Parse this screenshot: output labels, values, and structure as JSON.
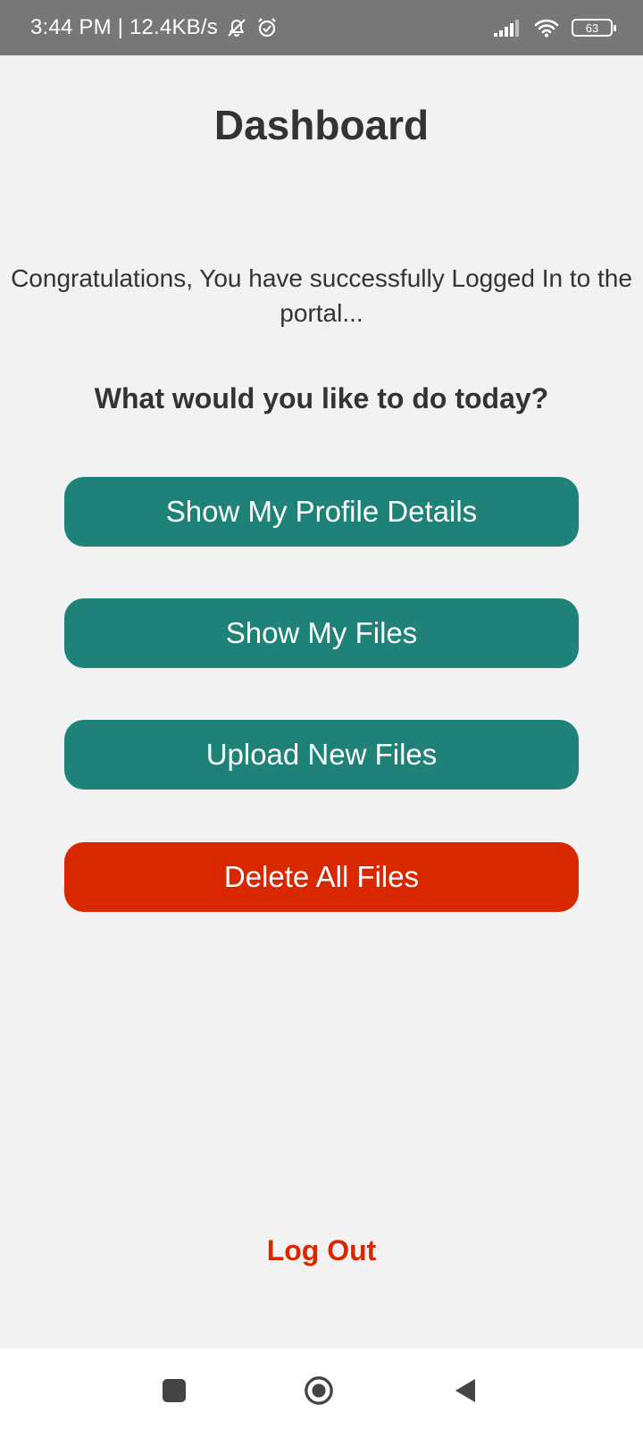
{
  "status_bar": {
    "time_and_speed": "3:44 PM | 12.4KB/s",
    "icons": [
      "mute-notification-icon",
      "alarm-icon",
      "signal-icon",
      "wifi-icon",
      "battery-icon"
    ],
    "battery_level": "63"
  },
  "main": {
    "title": "Dashboard",
    "message": "Congratulations, You have successfully Logged In to the portal...",
    "question": "What would you like to do today?",
    "buttons": [
      {
        "label": "Show My Profile Details",
        "color": "#1f8278"
      },
      {
        "label": "Show My Files",
        "color": "#1f8278"
      },
      {
        "label": "Upload New Files",
        "color": "#1f8278"
      },
      {
        "label": "Delete All Files",
        "color": "#d92800"
      }
    ],
    "logout_label": "Log Out"
  },
  "nav_bar": {
    "icons": [
      "recent-apps-icon",
      "home-icon",
      "back-icon"
    ]
  },
  "colors": {
    "background": "#f2f2f2",
    "accent_teal": "#1f8278",
    "danger_red": "#d92800",
    "text": "#333333",
    "status_bar": "#777777"
  }
}
